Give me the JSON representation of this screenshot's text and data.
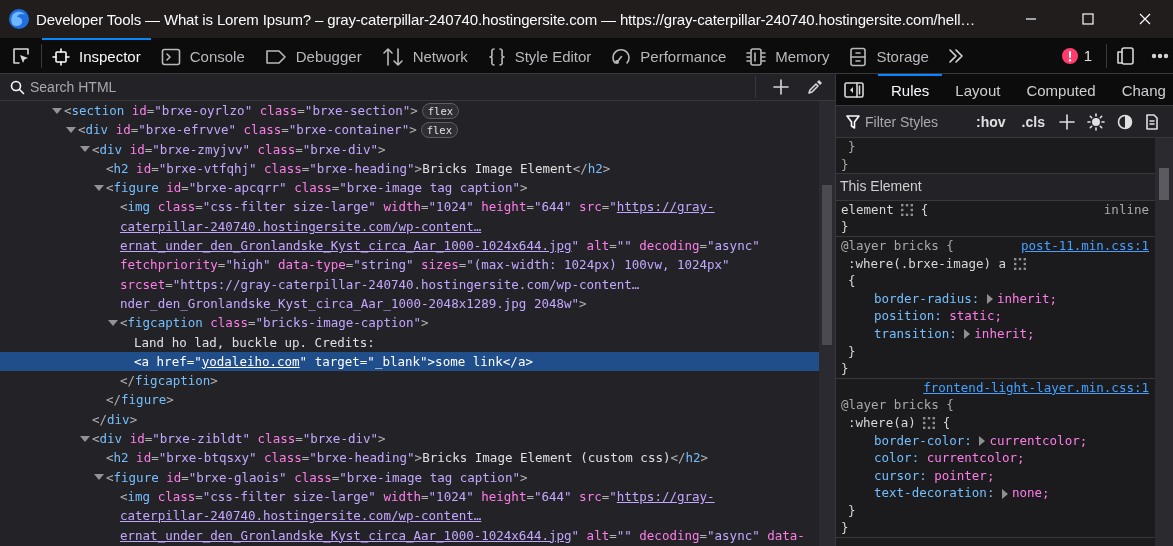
{
  "window": {
    "title": "Developer Tools — What is Lorem Ipsum? – gray-caterpillar-240740.hostingersite.com — https://gray-caterpillar-240740.hostingersite.com/hell…"
  },
  "toolbar": {
    "tabs": [
      {
        "label": "Inspector",
        "selected": true
      },
      {
        "label": "Console",
        "selected": false
      },
      {
        "label": "Debugger",
        "selected": false
      },
      {
        "label": "Network",
        "selected": false
      },
      {
        "label": "Style Editor",
        "selected": false
      },
      {
        "label": "Performance",
        "selected": false
      },
      {
        "label": "Memory",
        "selected": false
      },
      {
        "label": "Storage",
        "selected": false
      }
    ],
    "error_count": "1"
  },
  "markup": {
    "search": {
      "placeholder": "Search HTML"
    },
    "nodes": [
      {
        "lines": [
          [
            {
              "kind": "punct",
              "text": "<"
            },
            {
              "kind": "tag",
              "text": "section"
            },
            {
              "kind": "attr",
              "text": " id"
            },
            {
              "kind": "punct",
              "text": "="
            },
            {
              "kind": "value",
              "text": "\"brxe-oyrlzo\""
            },
            {
              "kind": "attr",
              "text": " class"
            },
            {
              "kind": "punct",
              "text": "="
            },
            {
              "kind": "value",
              "text": "\"brxe-section\""
            },
            {
              "kind": "punct",
              "text": ">"
            }
          ]
        ],
        "badge": "flex",
        "expanded": true,
        "selected": false,
        "children": [
          {
            "lines": [
              [
                {
                  "kind": "punct",
                  "text": "<"
                },
                {
                  "kind": "tag",
                  "text": "div"
                },
                {
                  "kind": "attr",
                  "text": " id"
                },
                {
                  "kind": "punct",
                  "text": "="
                },
                {
                  "kind": "value",
                  "text": "\"brxe-efrvve\""
                },
                {
                  "kind": "attr",
                  "text": " class"
                },
                {
                  "kind": "punct",
                  "text": "="
                },
                {
                  "kind": "value",
                  "text": "\"brxe-container\""
                },
                {
                  "kind": "punct",
                  "text": ">"
                }
              ]
            ],
            "badge": "flex",
            "expanded": true,
            "selected": false,
            "children": [
              {
                "lines": [
                  [
                    {
                      "kind": "punct",
                      "text": "<"
                    },
                    {
                      "kind": "tag",
                      "text": "div"
                    },
                    {
                      "kind": "attr",
                      "text": " id"
                    },
                    {
                      "kind": "punct",
                      "text": "="
                    },
                    {
                      "kind": "value",
                      "text": "\"brxe-zmyjvv\""
                    },
                    {
                      "kind": "attr",
                      "text": " class"
                    },
                    {
                      "kind": "punct",
                      "text": "="
                    },
                    {
                      "kind": "value",
                      "text": "\"brxe-div\""
                    },
                    {
                      "kind": "punct",
                      "text": ">"
                    }
                  ]
                ],
                "expanded": true,
                "selected": false,
                "closing": [
                  {
                    "kind": "punct",
                    "text": "</"
                  },
                  {
                    "kind": "tag",
                    "text": "div"
                  },
                  {
                    "kind": "punct",
                    "text": ">"
                  }
                ],
                "children": [
                  {
                    "lines": [
                      [
                        {
                          "kind": "punct",
                          "text": "<"
                        },
                        {
                          "kind": "tag",
                          "text": "h2"
                        },
                        {
                          "kind": "attr",
                          "text": " id"
                        },
                        {
                          "kind": "punct",
                          "text": "="
                        },
                        {
                          "kind": "value",
                          "text": "\"brxe-vtfqhj\""
                        },
                        {
                          "kind": "attr",
                          "text": " class"
                        },
                        {
                          "kind": "punct",
                          "text": "="
                        },
                        {
                          "kind": "value",
                          "text": "\"brxe-heading\""
                        },
                        {
                          "kind": "punct",
                          "text": ">"
                        },
                        {
                          "kind": "text",
                          "text": "Bricks Image Element"
                        },
                        {
                          "kind": "punct",
                          "text": "</"
                        },
                        {
                          "kind": "tag",
                          "text": "h2"
                        },
                        {
                          "kind": "punct",
                          "text": ">"
                        }
                      ]
                    ],
                    "selected": false
                  },
                  {
                    "lines": [
                      [
                        {
                          "kind": "punct",
                          "text": "<"
                        },
                        {
                          "kind": "tag",
                          "text": "figure"
                        },
                        {
                          "kind": "attr",
                          "text": " id"
                        },
                        {
                          "kind": "punct",
                          "text": "="
                        },
                        {
                          "kind": "value",
                          "text": "\"brxe-apcqrr\""
                        },
                        {
                          "kind": "attr",
                          "text": " class"
                        },
                        {
                          "kind": "punct",
                          "text": "="
                        },
                        {
                          "kind": "value",
                          "text": "\"brxe-image tag caption\""
                        },
                        {
                          "kind": "punct",
                          "text": ">"
                        }
                      ]
                    ],
                    "expanded": true,
                    "selected": false,
                    "closing": [
                      {
                        "kind": "punct",
                        "text": "</"
                      },
                      {
                        "kind": "tag",
                        "text": "figure"
                      },
                      {
                        "kind": "punct",
                        "text": ">"
                      }
                    ],
                    "children": [
                      {
                        "lines": [
                          [
                            {
                              "kind": "punct",
                              "text": "<"
                            },
                            {
                              "kind": "tag",
                              "text": "img"
                            },
                            {
                              "kind": "attr",
                              "text": " class"
                            },
                            {
                              "kind": "punct",
                              "text": "="
                            },
                            {
                              "kind": "value",
                              "text": "\"css-filter size-large\""
                            },
                            {
                              "kind": "attr",
                              "text": " width"
                            },
                            {
                              "kind": "punct",
                              "text": "="
                            },
                            {
                              "kind": "value",
                              "text": "\"1024\""
                            },
                            {
                              "kind": "attr",
                              "text": " height"
                            },
                            {
                              "kind": "punct",
                              "text": "="
                            },
                            {
                              "kind": "value",
                              "text": "\"644\""
                            },
                            {
                              "kind": "attr",
                              "text": " src"
                            },
                            {
                              "kind": "punct",
                              "text": "="
                            },
                            {
                              "kind": "value",
                              "text": "\""
                            },
                            {
                              "kind": "link",
                              "text": "https://gray-"
                            }
                          ],
                          [
                            {
                              "kind": "link",
                              "text": "caterpillar-240740.hostingersite.com/wp-content…"
                            }
                          ],
                          [
                            {
                              "kind": "link",
                              "text": "ernat_under_den_Gronlandske_Kyst_circa_Aar_1000-1024x644.jpg"
                            },
                            {
                              "kind": "value",
                              "text": "\""
                            },
                            {
                              "kind": "attr",
                              "text": " alt"
                            },
                            {
                              "kind": "punct",
                              "text": "="
                            },
                            {
                              "kind": "value",
                              "text": "\"\""
                            },
                            {
                              "kind": "attr",
                              "text": " decoding"
                            },
                            {
                              "kind": "punct",
                              "text": "="
                            },
                            {
                              "kind": "value",
                              "text": "\"async\""
                            }
                          ],
                          [
                            {
                              "kind": "attr",
                              "text": "fetchpriority"
                            },
                            {
                              "kind": "punct",
                              "text": "="
                            },
                            {
                              "kind": "value",
                              "text": "\"high\""
                            },
                            {
                              "kind": "attr",
                              "text": " data-type"
                            },
                            {
                              "kind": "punct",
                              "text": "="
                            },
                            {
                              "kind": "value",
                              "text": "\"string\""
                            },
                            {
                              "kind": "attr",
                              "text": " sizes"
                            },
                            {
                              "kind": "punct",
                              "text": "="
                            },
                            {
                              "kind": "value",
                              "text": "\"(max-width: 1024px) 100vw, 1024px\""
                            }
                          ],
                          [
                            {
                              "kind": "attr",
                              "text": "srcset"
                            },
                            {
                              "kind": "punct",
                              "text": "="
                            },
                            {
                              "kind": "value",
                              "text": "\"https://gray-caterpillar-240740.hostingersite.com/wp-content…"
                            }
                          ],
                          [
                            {
                              "kind": "value",
                              "text": "nder_den_Gronlandske_Kyst_circa_Aar_1000-2048x1289.jpg 2048w\""
                            },
                            {
                              "kind": "punct",
                              "text": ">"
                            }
                          ]
                        ],
                        "selected": false
                      },
                      {
                        "lines": [
                          [
                            {
                              "kind": "punct",
                              "text": "<"
                            },
                            {
                              "kind": "tag",
                              "text": "figcaption"
                            },
                            {
                              "kind": "attr",
                              "text": " class"
                            },
                            {
                              "kind": "punct",
                              "text": "="
                            },
                            {
                              "kind": "value",
                              "text": "\"bricks-image-caption\""
                            },
                            {
                              "kind": "punct",
                              "text": ">"
                            }
                          ]
                        ],
                        "expanded": true,
                        "selected": false,
                        "closing": [
                          {
                            "kind": "punct",
                            "text": "</"
                          },
                          {
                            "kind": "tag",
                            "text": "figcaption"
                          },
                          {
                            "kind": "punct",
                            "text": ">"
                          }
                        ],
                        "children": [
                          {
                            "lines": [
                              [
                                {
                                  "kind": "text",
                                  "text": "Land ho lad, buckle up. Credits:"
                                }
                              ]
                            ],
                            "selected": false
                          },
                          {
                            "lines": [
                              [
                                {
                                  "kind": "punct",
                                  "text": "<"
                                },
                                {
                                  "kind": "tag",
                                  "text": "a"
                                },
                                {
                                  "kind": "attr",
                                  "text": " href"
                                },
                                {
                                  "kind": "punct",
                                  "text": "="
                                },
                                {
                                  "kind": "value",
                                  "text": "\""
                                },
                                {
                                  "kind": "link",
                                  "text": "yodaleiho.com"
                                },
                                {
                                  "kind": "value",
                                  "text": "\""
                                },
                                {
                                  "kind": "attr",
                                  "text": " target"
                                },
                                {
                                  "kind": "punct",
                                  "text": "="
                                },
                                {
                                  "kind": "value",
                                  "text": "\"_blank\""
                                },
                                {
                                  "kind": "punct",
                                  "text": ">"
                                },
                                {
                                  "kind": "text",
                                  "text": "some link"
                                },
                                {
                                  "kind": "punct",
                                  "text": "</"
                                },
                                {
                                  "kind": "tag",
                                  "text": "a"
                                },
                                {
                                  "kind": "punct",
                                  "text": ">"
                                }
                              ]
                            ],
                            "selected": true
                          }
                        ]
                      }
                    ]
                  }
                ]
              },
              {
                "lines": [
                  [
                    {
                      "kind": "punct",
                      "text": "<"
                    },
                    {
                      "kind": "tag",
                      "text": "div"
                    },
                    {
                      "kind": "attr",
                      "text": " id"
                    },
                    {
                      "kind": "punct",
                      "text": "="
                    },
                    {
                      "kind": "value",
                      "text": "\"brxe-zibldt\""
                    },
                    {
                      "kind": "attr",
                      "text": " class"
                    },
                    {
                      "kind": "punct",
                      "text": "="
                    },
                    {
                      "kind": "value",
                      "text": "\"brxe-div\""
                    },
                    {
                      "kind": "punct",
                      "text": ">"
                    }
                  ]
                ],
                "expanded": true,
                "selected": false,
                "children": [
                  {
                    "lines": [
                      [
                        {
                          "kind": "punct",
                          "text": "<"
                        },
                        {
                          "kind": "tag",
                          "text": "h2"
                        },
                        {
                          "kind": "attr",
                          "text": " id"
                        },
                        {
                          "kind": "punct",
                          "text": "="
                        },
                        {
                          "kind": "value",
                          "text": "\"brxe-btqsxy\""
                        },
                        {
                          "kind": "attr",
                          "text": " class"
                        },
                        {
                          "kind": "punct",
                          "text": "="
                        },
                        {
                          "kind": "value",
                          "text": "\"brxe-heading\""
                        },
                        {
                          "kind": "punct",
                          "text": ">"
                        },
                        {
                          "kind": "text",
                          "text": "Bricks Image Element (custom css)"
                        },
                        {
                          "kind": "punct",
                          "text": "</"
                        },
                        {
                          "kind": "tag",
                          "text": "h2"
                        },
                        {
                          "kind": "punct",
                          "text": ">"
                        }
                      ]
                    ],
                    "selected": false
                  },
                  {
                    "lines": [
                      [
                        {
                          "kind": "punct",
                          "text": "<"
                        },
                        {
                          "kind": "tag",
                          "text": "figure"
                        },
                        {
                          "kind": "attr",
                          "text": " id"
                        },
                        {
                          "kind": "punct",
                          "text": "="
                        },
                        {
                          "kind": "value",
                          "text": "\"brxe-glaois\""
                        },
                        {
                          "kind": "attr",
                          "text": " class"
                        },
                        {
                          "kind": "punct",
                          "text": "="
                        },
                        {
                          "kind": "value",
                          "text": "\"brxe-image tag caption\""
                        },
                        {
                          "kind": "punct",
                          "text": ">"
                        }
                      ]
                    ],
                    "expanded": true,
                    "selected": false,
                    "children": [
                      {
                        "lines": [
                          [
                            {
                              "kind": "punct",
                              "text": "<"
                            },
                            {
                              "kind": "tag",
                              "text": "img"
                            },
                            {
                              "kind": "attr",
                              "text": " class"
                            },
                            {
                              "kind": "punct",
                              "text": "="
                            },
                            {
                              "kind": "value",
                              "text": "\"css-filter size-large\""
                            },
                            {
                              "kind": "attr",
                              "text": " width"
                            },
                            {
                              "kind": "punct",
                              "text": "="
                            },
                            {
                              "kind": "value",
                              "text": "\"1024\""
                            },
                            {
                              "kind": "attr",
                              "text": " height"
                            },
                            {
                              "kind": "punct",
                              "text": "="
                            },
                            {
                              "kind": "value",
                              "text": "\"644\""
                            },
                            {
                              "kind": "attr",
                              "text": " src"
                            },
                            {
                              "kind": "punct",
                              "text": "="
                            },
                            {
                              "kind": "value",
                              "text": "\""
                            },
                            {
                              "kind": "link",
                              "text": "https://gray-"
                            }
                          ],
                          [
                            {
                              "kind": "link",
                              "text": "caterpillar-240740.hostingersite.com/wp-content…"
                            }
                          ],
                          [
                            {
                              "kind": "link",
                              "text": "ernat_under_den_Gronlandske_Kyst_circa_Aar_1000-1024x644.jpg"
                            },
                            {
                              "kind": "value",
                              "text": "\""
                            },
                            {
                              "kind": "attr",
                              "text": " alt"
                            },
                            {
                              "kind": "punct",
                              "text": "="
                            },
                            {
                              "kind": "value",
                              "text": "\"\""
                            },
                            {
                              "kind": "attr",
                              "text": " decoding"
                            },
                            {
                              "kind": "punct",
                              "text": "="
                            },
                            {
                              "kind": "value",
                              "text": "\"async\""
                            },
                            {
                              "kind": "attr",
                              "text": " data-"
                            }
                          ]
                        ],
                        "selected": false
                      }
                    ]
                  }
                ]
              }
            ]
          }
        ]
      }
    ]
  },
  "rules_panel": {
    "tabs": [
      {
        "label": "Rules",
        "selected": true
      },
      {
        "label": "Layout",
        "selected": false
      },
      {
        "label": "Computed",
        "selected": false
      },
      {
        "label": "Chang",
        "selected": false
      }
    ],
    "filter": {
      "placeholder": "Filter Styles"
    },
    "toggles": [
      ":hov",
      ".cls"
    ],
    "blocks": [
      {
        "kind": "fragment",
        "inner_close": "}",
        "outer_close": "}"
      },
      {
        "kind": "header",
        "title": "This Element"
      },
      {
        "kind": "element",
        "selector": "element",
        "open": "{",
        "origin": "inline",
        "close": "}"
      },
      {
        "kind": "layer",
        "source": "post-11.min.css:1",
        "layer": "@layer bricks {",
        "selector": ":where(.brxe-image) a",
        "open": "{",
        "declarations": [
          {
            "property": "border-radius:",
            "value": "inherit;",
            "expandable": true
          },
          {
            "property": "position:",
            "value": "static;",
            "expandable": false
          },
          {
            "property": "transition:",
            "value": "inherit;",
            "expandable": true
          }
        ],
        "inner_close": "}",
        "outer_close": "}"
      },
      {
        "kind": "layer",
        "source": "frontend-light-layer.min.css:1",
        "layer": "@layer bricks {",
        "selector": ":where(a)",
        "open": "{",
        "declarations": [
          {
            "property": "border-color:",
            "value": "currentcolor;",
            "expandable": true
          },
          {
            "property": "color:",
            "value": "currentcolor;",
            "expandable": false
          },
          {
            "property": "cursor:",
            "value": "pointer;",
            "expandable": false
          },
          {
            "property": "text-decoration:",
            "value": "none;",
            "expandable": true
          }
        ],
        "inner_close": "}",
        "outer_close": "}"
      }
    ]
  }
}
